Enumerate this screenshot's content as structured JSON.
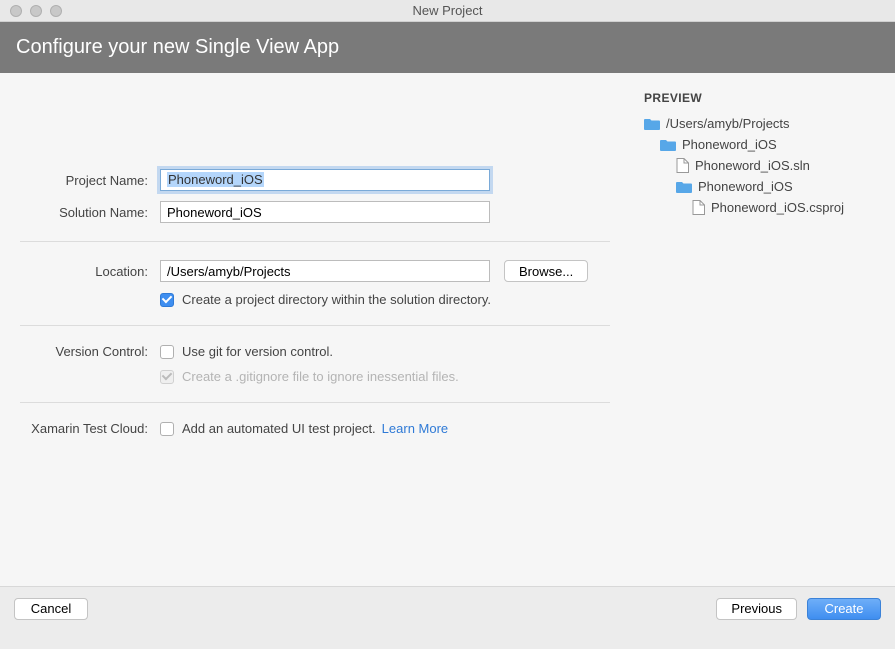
{
  "window": {
    "title": "New Project"
  },
  "header": {
    "title": "Configure your new Single View App"
  },
  "form": {
    "projectName": {
      "label": "Project Name:",
      "value": "Phoneword_iOS"
    },
    "solutionName": {
      "label": "Solution Name:",
      "value": "Phoneword_iOS"
    },
    "location": {
      "label": "Location:",
      "value": "/Users/amyb/Projects",
      "browse": "Browse..."
    },
    "createDir": {
      "label": "Create a project directory within the solution directory.",
      "checked": true
    },
    "versionControl": {
      "sectionLabel": "Version Control:",
      "useGit": {
        "label": "Use git for version control.",
        "checked": false
      },
      "gitignore": {
        "label": "Create a .gitignore file to ignore inessential files.",
        "checked": true,
        "disabled": true
      }
    },
    "testCloud": {
      "sectionLabel": "Xamarin Test Cloud:",
      "addTest": {
        "label": "Add an automated UI test project.",
        "checked": false
      },
      "learnMore": "Learn More"
    }
  },
  "preview": {
    "title": "PREVIEW",
    "tree": {
      "root": "/Users/amyb/Projects",
      "solutionFolder": "Phoneword_iOS",
      "solutionFile": "Phoneword_iOS.sln",
      "projectFolder": "Phoneword_iOS",
      "projectFile": "Phoneword_iOS.csproj"
    }
  },
  "buttons": {
    "cancel": "Cancel",
    "previous": "Previous",
    "create": "Create"
  }
}
